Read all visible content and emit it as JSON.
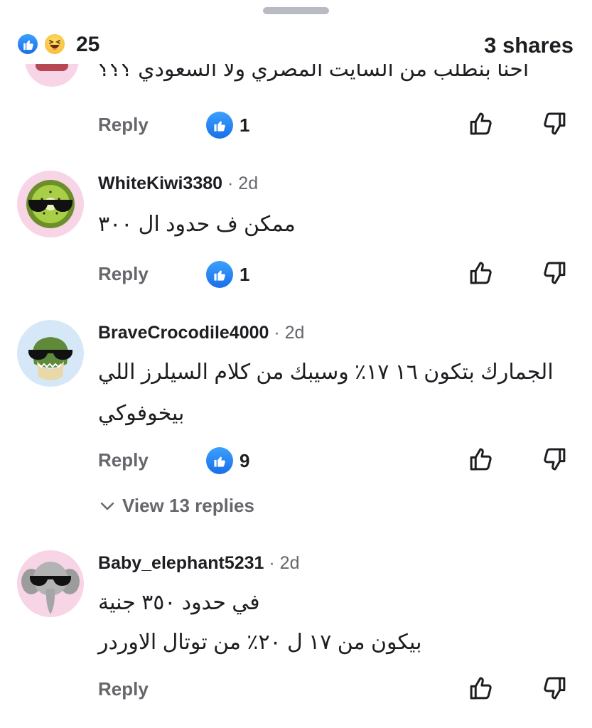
{
  "summary": {
    "reaction_count": "25",
    "shares_label": "3 shares",
    "reaction_icons": [
      "like-icon",
      "haha-icon"
    ],
    "accent_color": "#1877f2"
  },
  "partial_comment": {
    "text": "احنا بنطلب من السايت المصري ولا السعودي ؟؟؟",
    "reply_label": "Reply",
    "like_count": "1"
  },
  "comments": [
    {
      "author": "WhiteKiwi3380",
      "time": "· 2d",
      "lines": [
        "ممكن ف حدود ال ٣٠٠"
      ],
      "reply_label": "Reply",
      "like_count": "1"
    },
    {
      "author": "BraveCrocodile4000",
      "time": "· 2d",
      "lines": [
        "الجمارك بتكون ١٦ ١٧٪ وسيبك من كلام السيلرز اللي",
        "بيخوفوكي"
      ],
      "reply_label": "Reply",
      "like_count": "9",
      "view_replies_label": "View 13 replies"
    },
    {
      "author": "Baby_elephant5231",
      "time": "· 2d",
      "lines": [
        "في حدود ٣٥٠ جنية",
        "بيكون من ١٧ ل ٢٠٪ من توتال الاوردر"
      ],
      "reply_label": "Reply"
    }
  ]
}
